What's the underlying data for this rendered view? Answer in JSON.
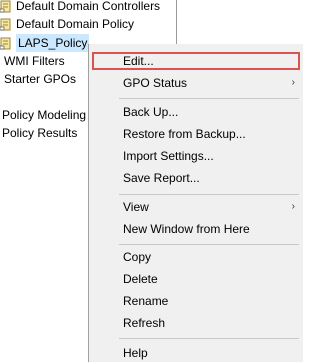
{
  "tree": {
    "items": [
      {
        "label": "Default Domain Controllers",
        "icon": "gpo-link-icon"
      },
      {
        "label": "Default Domain Policy",
        "icon": "gpo-link-icon"
      },
      {
        "label": "LAPS_Policy",
        "icon": "gpo-link-icon",
        "selected": true
      },
      {
        "label": "WMI Filters"
      },
      {
        "label": "Starter GPOs"
      },
      {
        "label": "Policy Modeling"
      },
      {
        "label": "Policy Results"
      }
    ]
  },
  "context_menu": {
    "items": [
      {
        "label": "Edit...",
        "highlighted": true
      },
      {
        "label": "GPO Status",
        "submenu": true
      },
      {
        "label": "Back Up..."
      },
      {
        "label": "Restore from Backup..."
      },
      {
        "label": "Import Settings..."
      },
      {
        "label": "Save Report..."
      },
      {
        "label": "View",
        "submenu": true
      },
      {
        "label": "New Window from Here"
      },
      {
        "label": "Copy"
      },
      {
        "label": "Delete"
      },
      {
        "label": "Rename"
      },
      {
        "label": "Refresh"
      },
      {
        "label": "Help"
      }
    ],
    "submenu_arrow": "›",
    "highlight_color": "#d9534f"
  }
}
